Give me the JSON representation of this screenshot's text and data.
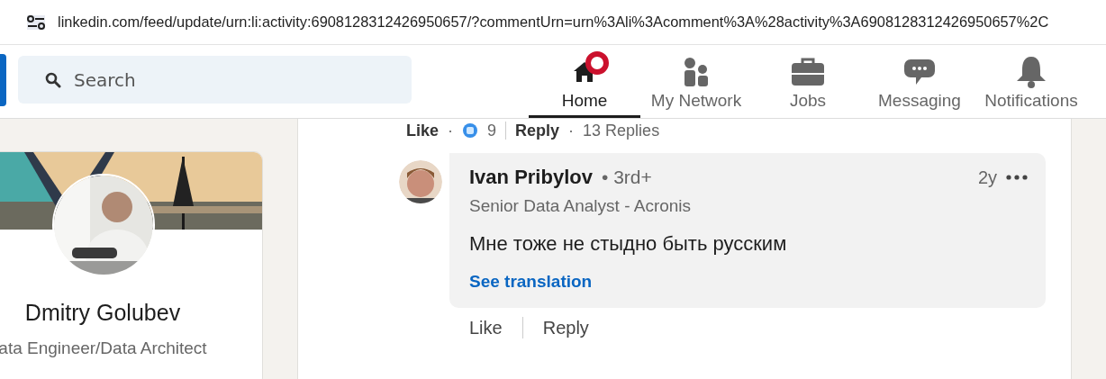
{
  "address_bar": {
    "url": "linkedin.com/feed/update/urn:li:activity:6908128312426950657/?commentUrn=urn%3Ali%3Acomment%3A%28activity%3A6908128312426950657%2C"
  },
  "search": {
    "placeholder": "Search"
  },
  "nav": [
    {
      "label": "Home",
      "kind": "home",
      "selected": true,
      "badge": true
    },
    {
      "label": "My Network",
      "kind": "network",
      "selected": false,
      "badge": false
    },
    {
      "label": "Jobs",
      "kind": "jobs",
      "selected": false,
      "badge": false
    },
    {
      "label": "Messaging",
      "kind": "messaging",
      "selected": false,
      "badge": false
    },
    {
      "label": "Notifications",
      "kind": "notifications",
      "selected": false,
      "badge": false
    }
  ],
  "profile": {
    "name": "Dmitry Golubev",
    "headline": "ata Engineer/Data Architect"
  },
  "previous_actions": {
    "like": "Like",
    "separator": "·",
    "reactions": "9",
    "reply": "Reply",
    "separator_2": "·",
    "replies": "13 Replies"
  },
  "comment": {
    "author": "Ivan Pribylov",
    "degree": "• 3rd+",
    "subtitle": "Senior Data Analyst - Acronis",
    "time": "2y",
    "text": "Мне тоже не стыдно быть русским",
    "translate": "See translation",
    "actions": [
      "Like",
      "Reply"
    ]
  }
}
